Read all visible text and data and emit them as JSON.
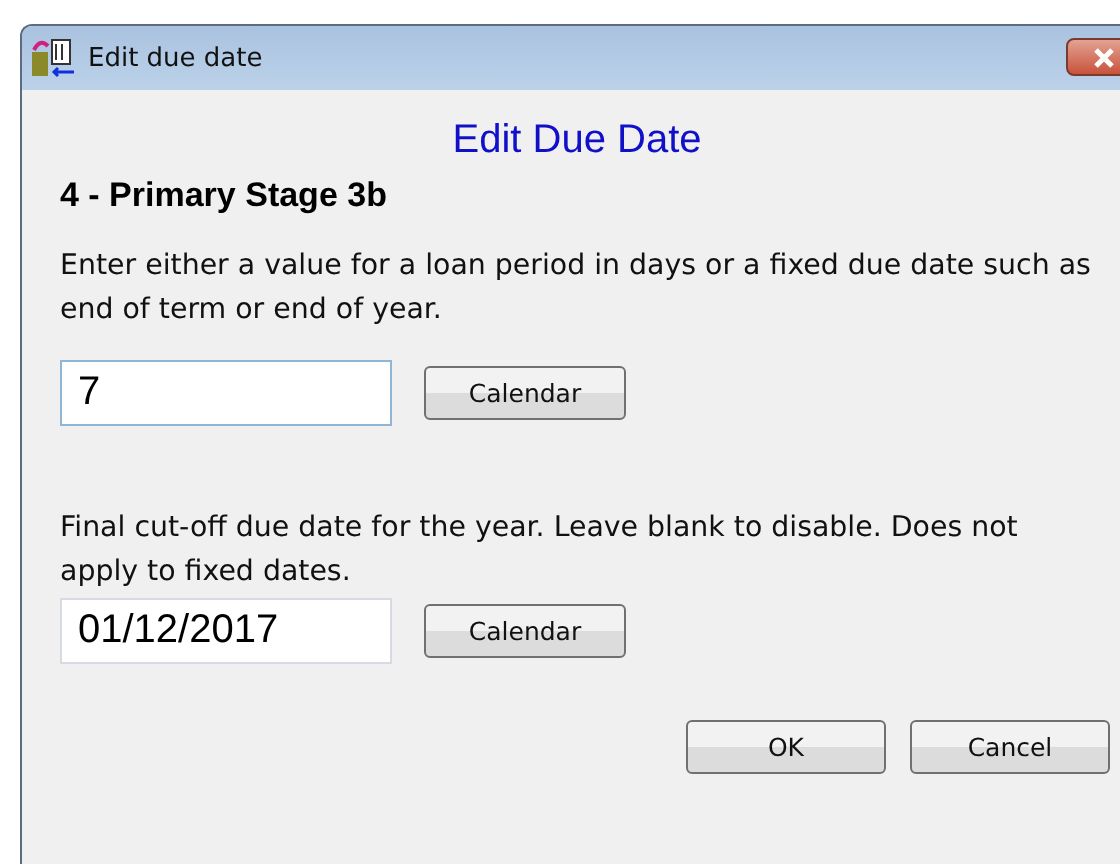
{
  "window": {
    "title": "Edit due date"
  },
  "heading": "Edit Due Date",
  "subtitle": "4 - Primary Stage 3b",
  "sections": [
    {
      "description": "Enter either a value for a loan period in days or a fixed due date such as end of term or end of year.",
      "field": {
        "value": "7",
        "focused": true
      },
      "button": "Calendar"
    },
    {
      "description": "Final cut-off due date for the year. Leave blank to disable. Does not apply to fixed dates.",
      "field": {
        "value": "01/12/2017",
        "focused": false
      },
      "button": "Calendar"
    }
  ],
  "buttons": [
    "OK",
    "Cancel"
  ]
}
